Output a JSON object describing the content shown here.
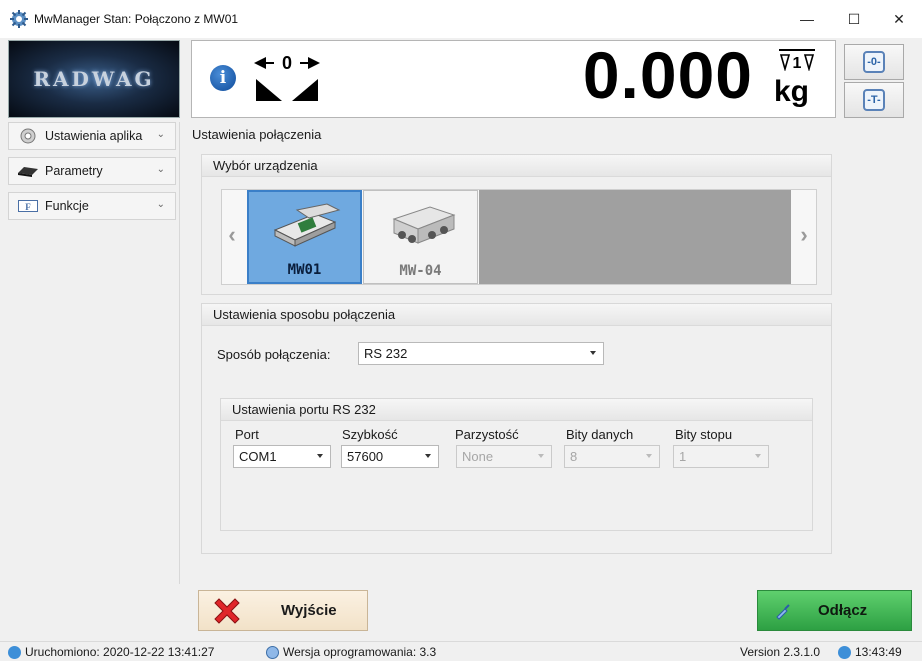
{
  "window": {
    "title": "MwManager  Stan: Połączono z MW01",
    "minimize_glyph": "—",
    "maximize_glyph": "☐",
    "close_glyph": "✕"
  },
  "header": {
    "logo_text": "RADWAG",
    "info_icon": "i",
    "zero_arrow_label": "0",
    "weight": "0.000",
    "range_label": "1",
    "unit": "kg",
    "zero_button_icon": "-0-",
    "tare_button_icon": "-T-"
  },
  "sidebar": {
    "items": [
      {
        "label": "Ustawienia aplika",
        "icon": "gear-icon"
      },
      {
        "label": "Parametry",
        "icon": "scale-icon"
      },
      {
        "label": "Funkcje",
        "icon": "function-icon"
      }
    ]
  },
  "main": {
    "title": "Ustawienia połączenia",
    "device_group": {
      "title": "Wybór urządzenia",
      "devices": [
        {
          "label": "MW01",
          "selected": true
        },
        {
          "label": "MW-04",
          "selected": false
        }
      ]
    },
    "connection_group": {
      "title": "Ustawienia sposobu połączenia",
      "method_label": "Sposób połączenia:",
      "method_value": "RS 232",
      "port_group": {
        "title": "Ustawienia portu RS 232",
        "columns": [
          {
            "label": "Port",
            "value": "COM1",
            "enabled": true
          },
          {
            "label": "Szybkość",
            "value": "57600",
            "enabled": true
          },
          {
            "label": "Parzystość",
            "value": "None",
            "enabled": false
          },
          {
            "label": "Bity danych",
            "value": "8",
            "enabled": false
          },
          {
            "label": "Bity stopu",
            "value": "1",
            "enabled": false
          }
        ]
      }
    }
  },
  "buttons": {
    "exit_label": "Wyjście",
    "disconnect_label": "Odłącz"
  },
  "status": {
    "started": "Uruchomiono: 2020-12-22 13:41:27",
    "firmware": "Wersja oprogramowania: 3.3",
    "version": "Version 2.3.1.0",
    "clock": "13:43:49"
  },
  "colors": {
    "selected_device": "#6fa9e0",
    "disconnect_green": "#2da043",
    "exit_bg": "#f2e2c8"
  }
}
